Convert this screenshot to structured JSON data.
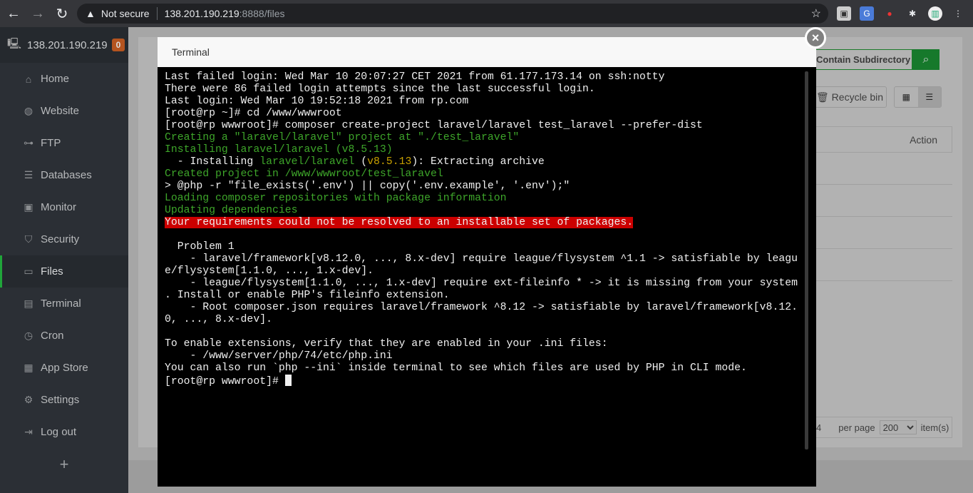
{
  "browser": {
    "not_secure": "Not secure",
    "url_host": "138.201.190.219",
    "url_rest": ":8888/files"
  },
  "sidebar": {
    "server": "138.201.190.219",
    "badge": "0",
    "items": [
      {
        "label": "Home",
        "icon": "home-icon"
      },
      {
        "label": "Website",
        "icon": "globe-icon"
      },
      {
        "label": "FTP",
        "icon": "ftp-icon"
      },
      {
        "label": "Databases",
        "icon": "database-icon"
      },
      {
        "label": "Monitor",
        "icon": "monitor-icon"
      },
      {
        "label": "Security",
        "icon": "shield-icon"
      },
      {
        "label": "Files",
        "icon": "folder-icon",
        "active": true
      },
      {
        "label": "Terminal",
        "icon": "terminal-icon"
      },
      {
        "label": "Cron",
        "icon": "clock-icon"
      },
      {
        "label": "App Store",
        "icon": "apps-icon"
      },
      {
        "label": "Settings",
        "icon": "gear-icon"
      },
      {
        "label": "Log out",
        "icon": "logout-icon"
      }
    ],
    "add": "+"
  },
  "files": {
    "search_label": "Contain Subdirectory",
    "recycle_bin": "Recycle bin",
    "action_header": "Action",
    "page_fragment": "4",
    "per_page_label": "per page",
    "per_page_value": "200",
    "items_label": "item(s)"
  },
  "modal": {
    "title": "Terminal",
    "close": "×"
  },
  "colors": {
    "white": "#f0f0f0",
    "green": "#3ea62a",
    "yellow": "#c8a000",
    "error_bg": "#cc0000",
    "accent": "#20a53a"
  },
  "terminal": {
    "lines": [
      [
        {
          "t": "Last failed login: Wed Mar 10 20:07:27 CET 2021 from 61.177.173.14 on ssh:notty"
        }
      ],
      [
        {
          "t": "There were 86 failed login attempts since the last successful login."
        }
      ],
      [
        {
          "t": "Last login: Wed Mar 10 19:52:18 2021 from rp.com"
        }
      ],
      [
        {
          "t": "[root@rp ~]# cd /www/wwwroot"
        }
      ],
      [
        {
          "t": "[root@rp wwwroot]# composer create-project laravel/laravel test_laravel --prefer-dist"
        }
      ],
      [
        {
          "t": "Creating a \"laravel/laravel\" project at \"./test_laravel\"",
          "c": "green"
        }
      ],
      [
        {
          "t": "Installing laravel/laravel (v8.5.13)",
          "c": "green"
        }
      ],
      [
        {
          "t": "  - Installing "
        },
        {
          "t": "laravel/laravel",
          "c": "green"
        },
        {
          "t": " ("
        },
        {
          "t": "v8.5.13",
          "c": "yellow"
        },
        {
          "t": "): Extracting archive"
        }
      ],
      [
        {
          "t": "Created project in /www/wwwroot/test_laravel",
          "c": "green"
        }
      ],
      [
        {
          "t": "> @php -r \"file_exists('.env') || copy('.env.example', '.env');\""
        }
      ],
      [
        {
          "t": "Loading composer repositories with package information",
          "c": "green"
        }
      ],
      [
        {
          "t": "Updating dependencies",
          "c": "green"
        }
      ],
      [
        {
          "t": "Your requirements could not be resolved to an installable set of packages.",
          "bg": "error_bg"
        }
      ],
      [
        {
          "t": ""
        }
      ],
      [
        {
          "t": "  Problem 1"
        }
      ],
      [
        {
          "t": "    - laravel/framework[v8.12.0, ..., 8.x-dev] require league/flysystem ^1.1 -> satisfiable by leagu"
        }
      ],
      [
        {
          "t": "e/flysystem[1.1.0, ..., 1.x-dev]."
        }
      ],
      [
        {
          "t": "    - league/flysystem[1.1.0, ..., 1.x-dev] require ext-fileinfo * -> it is missing from your system"
        }
      ],
      [
        {
          "t": ". Install or enable PHP's fileinfo extension."
        }
      ],
      [
        {
          "t": "    - Root composer.json requires laravel/framework ^8.12 -> satisfiable by laravel/framework[v8.12."
        }
      ],
      [
        {
          "t": "0, ..., 8.x-dev]."
        }
      ],
      [
        {
          "t": ""
        }
      ],
      [
        {
          "t": "To enable extensions, verify that they are enabled in your .ini files:"
        }
      ],
      [
        {
          "t": "    - /www/server/php/74/etc/php.ini"
        }
      ],
      [
        {
          "t": "You can also run `php --ini` inside terminal to see which files are used by PHP in CLI mode."
        }
      ],
      [
        {
          "t": "[root@rp wwwroot]# "
        }
      ]
    ]
  }
}
